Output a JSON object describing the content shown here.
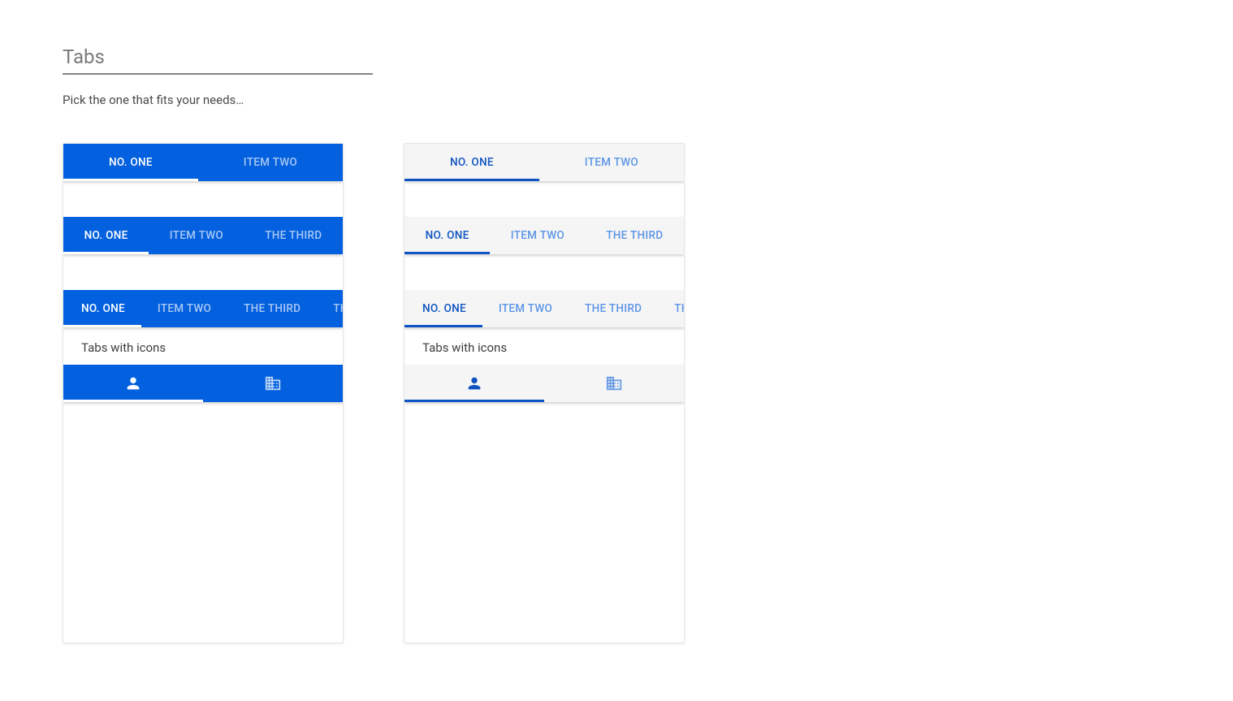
{
  "header": {
    "title": "Tabs",
    "subtitle": "Pick the one that fits your needs…"
  },
  "section": {
    "icons_label": "Tabs with icons"
  },
  "tabs": {
    "two": [
      "NO. ONE",
      "ITEM TWO"
    ],
    "three": [
      "NO. ONE",
      "ITEM TWO",
      "THE THIRD"
    ],
    "four": [
      "NO. ONE",
      "ITEM TWO",
      "THE THIRD",
      "THE FOURTH"
    ]
  },
  "icons": [
    "person-icon",
    "company-icon"
  ]
}
